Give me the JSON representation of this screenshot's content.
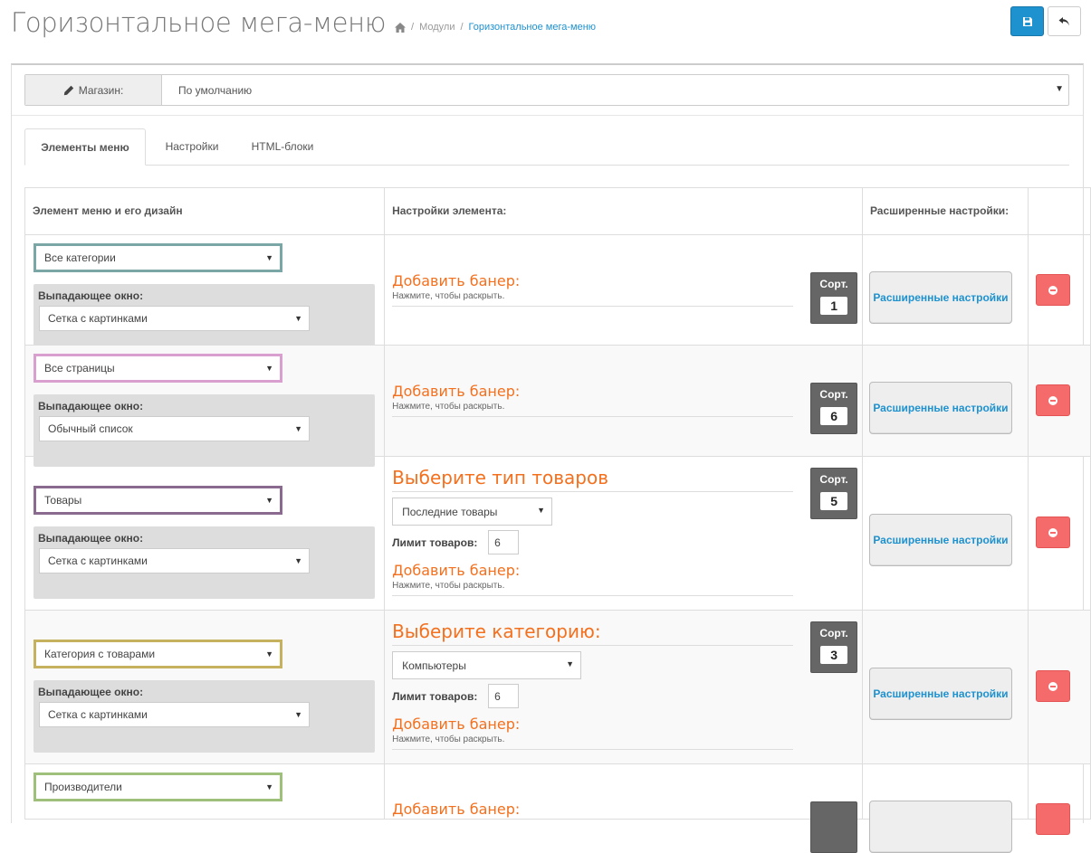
{
  "header": {
    "title": "Горизонтальное мега-меню",
    "breadcrumb": [
      "Модули",
      "Горизонтальное мега-меню"
    ],
    "save_icon": "save-icon",
    "back_icon": "reply-icon"
  },
  "store": {
    "label": "Магазин:",
    "value": "По умолчанию"
  },
  "tabs": [
    "Элементы меню",
    "Настройки",
    "HTML-блоки"
  ],
  "table": {
    "headers": [
      "Элемент меню и его дизайн",
      "Настройки элемента:",
      "Расширенные настройки:",
      ""
    ],
    "dropdown_label": "Выпадающее окно:",
    "banner_title": "Добавить банер:",
    "banner_sub": "Нажмите, чтобы раскрыть.",
    "sort_label": "Сорт.",
    "advanced_label": "Расширенные настройки",
    "limit_label": "Лимит товаров:",
    "rows": [
      {
        "item": "Все категории",
        "color": "#7aa6a6",
        "dropdown": "Сетка с картинками",
        "sort": "1"
      },
      {
        "item": "Все страницы",
        "color": "#d9a0cf",
        "dropdown": "Обычный список",
        "sort": "6"
      },
      {
        "item": "Товары",
        "color": "#8a6a8e",
        "dropdown": "Сетка с картинками",
        "sort": "5",
        "extra_title": "Выберите тип товаров",
        "extra_select": "Последние товары",
        "limit": "6"
      },
      {
        "item": "Категория с товарами",
        "color": "#c6b25e",
        "dropdown": "Сетка с картинками",
        "sort": "3",
        "extra_title": "Выберите категорию:",
        "extra_select": "Компьютеры",
        "limit": "6"
      },
      {
        "item": "Производители",
        "color": "#9fc07a"
      }
    ]
  }
}
